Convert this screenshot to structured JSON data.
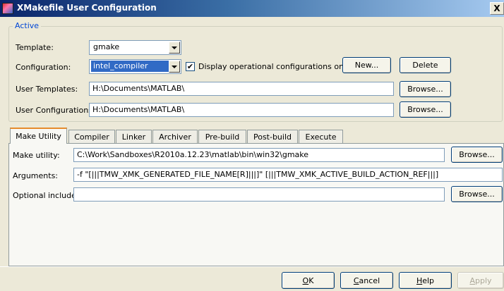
{
  "window": {
    "title": "XMakefile User Configuration",
    "close_label": "X"
  },
  "active_group": {
    "legend": "Active",
    "template_label": "Template:",
    "template_value": "gmake",
    "configuration_label": "Configuration:",
    "configuration_value": "intel_compiler",
    "display_operational_label": "Display operational configurations only",
    "display_operational_checked": true,
    "new_button": "New...",
    "delete_button": "Delete",
    "user_templates_label": "User Templates:",
    "user_templates_value": "H:\\Documents\\MATLAB\\",
    "user_configurations_label": "User Configurations:",
    "user_configurations_value": "H:\\Documents\\MATLAB\\",
    "browse_label": "Browse..."
  },
  "tabs": [
    {
      "label": "Make Utility",
      "active": true
    },
    {
      "label": "Compiler"
    },
    {
      "label": "Linker"
    },
    {
      "label": "Archiver"
    },
    {
      "label": "Pre-build"
    },
    {
      "label": "Post-build"
    },
    {
      "label": "Execute"
    }
  ],
  "make_utility": {
    "make_utility_label": "Make utility:",
    "make_utility_value": "C:\\Work\\Sandboxes\\R2010a.12.23\\matlab\\bin\\win32\\gmake",
    "arguments_label": "Arguments:",
    "arguments_value": "-f \"[|||TMW_XMK_GENERATED_FILE_NAME[R]|||]\" [|||TMW_XMK_ACTIVE_BUILD_ACTION_REF|||]",
    "optional_include_label": "Optional include:",
    "optional_include_value": "",
    "browse_label": "Browse..."
  },
  "footer": {
    "ok_prefix": "",
    "ok_mnemonic": "O",
    "ok_rest": "K",
    "cancel_prefix": "",
    "cancel_mnemonic": "C",
    "cancel_rest": "ancel",
    "help_prefix": "",
    "help_mnemonic": "H",
    "help_rest": "elp",
    "apply_prefix": "",
    "apply_mnemonic": "A",
    "apply_rest": "pply",
    "apply_enabled": false
  }
}
